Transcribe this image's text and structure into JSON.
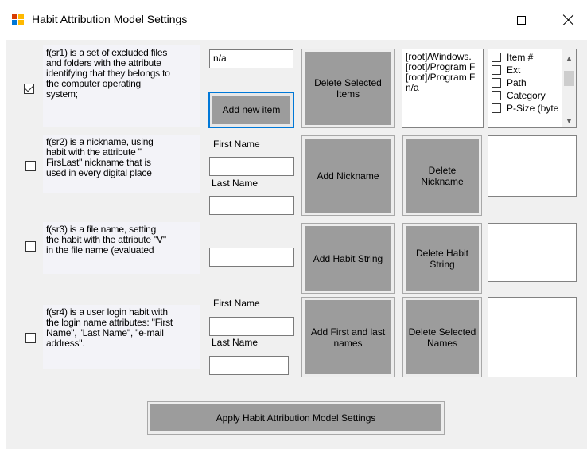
{
  "window": {
    "title": "Habit Attribution Model Settings",
    "icon": "form-icon"
  },
  "rows": [
    {
      "checked": true,
      "description": [
        "f(sr1) is a set of excluded files",
        "and folders with the attribute",
        "identifying that they belongs to",
        "the computer operating",
        "system;"
      ],
      "input_value": "n/a",
      "add_button": "Add new item",
      "action_button": "Delete Selected Items",
      "list": [
        "[root]/Windows.",
        "[root]/Program F",
        "[root]/Program F",
        "n/a"
      ]
    },
    {
      "checked": false,
      "description": [
        "f(sr2) is a nickname, using",
        "habit with the attribute \"",
        "FirsLast\" nickname that is",
        "used in every digital place"
      ],
      "first_name_label": "First Name",
      "last_name_label": "Last Name",
      "first_name_value": "",
      "last_name_value": "",
      "action_button": "Add Nickname",
      "delete_button": "Delete Nickname"
    },
    {
      "checked": false,
      "description": [
        "f(sr3) is a file name, setting",
        "the habit with the attribute \"V\"",
        "in the file name (evaluated"
      ],
      "input_value": "",
      "action_button": "Add Habit String",
      "delete_button": "Delete Habit String"
    },
    {
      "checked": false,
      "description": [
        "f(sr4) is a user login habit with",
        "the login name attributes: \"First",
        "Name\", \"Last Name\", \"e-mail",
        "address\"."
      ],
      "first_name_label": "First Name",
      "last_name_label": "Last Name",
      "first_name_value": "",
      "last_name_value": "",
      "email_value": "",
      "action_button": "Add First and last names",
      "delete_button": "Delete Selected Names"
    }
  ],
  "columns_list": {
    "items": [
      "Item #",
      "Ext",
      "Path",
      "Category",
      "P-Size (byte"
    ]
  },
  "apply_button": "Apply Habit Attribution Model Settings"
}
